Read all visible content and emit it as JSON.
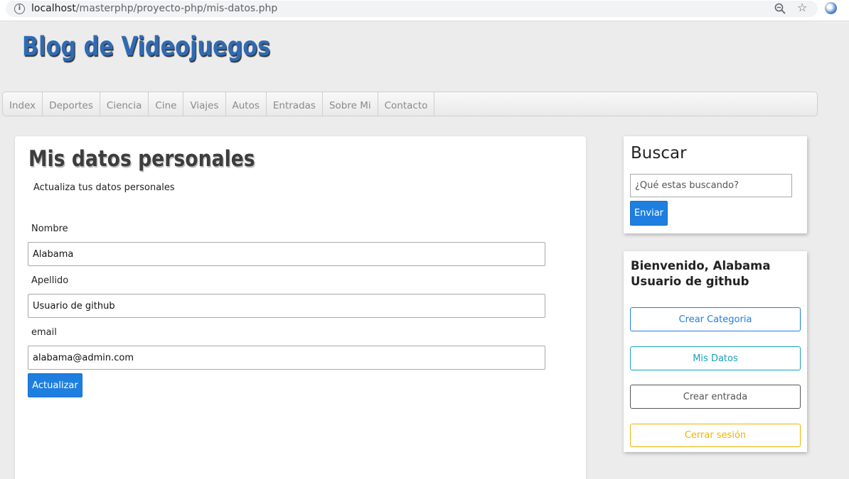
{
  "browser": {
    "url_host": "localhost",
    "url_path": "/masterphp/proyecto-php/mis-datos.php"
  },
  "site": {
    "title": "Blog de Videojuegos"
  },
  "nav": {
    "items": [
      "Index",
      "Deportes",
      "Ciencia",
      "Cine",
      "Viajes",
      "Autos",
      "Entradas",
      "Sobre Mi",
      "Contacto"
    ]
  },
  "main": {
    "title": "Mis datos personales",
    "subtitle": "Actualiza tus datos personales",
    "fields": {
      "nombre": {
        "label": "Nombre",
        "value": "Alabama"
      },
      "apellido": {
        "label": "Apellido",
        "value": "Usuario de github"
      },
      "email": {
        "label": "email",
        "value": "alabama@admin.com"
      }
    },
    "submit_label": "Actualizar"
  },
  "sidebar": {
    "search": {
      "title": "Buscar",
      "placeholder": "¿Qué estas buscando?",
      "button_label": "Enviar"
    },
    "user": {
      "welcome": "Bienvenido, Alabama Usuario de github",
      "buttons": [
        {
          "label": "Crear Categoria",
          "color": "#1e7fe0"
        },
        {
          "label": "Mis Datos",
          "color": "#17a2b8"
        },
        {
          "label": "Crear entrada",
          "color": "#555555"
        },
        {
          "label": "Cerrar sesión",
          "color": "#f0b400"
        }
      ]
    }
  },
  "colors": {
    "brand": "#2f6bb5",
    "primary": "#1e7fe0"
  },
  "icons": {
    "site_info": "info-icon",
    "zoom": "zoom-out-icon",
    "bookmark": "star-icon",
    "extension": "extension-icon"
  }
}
